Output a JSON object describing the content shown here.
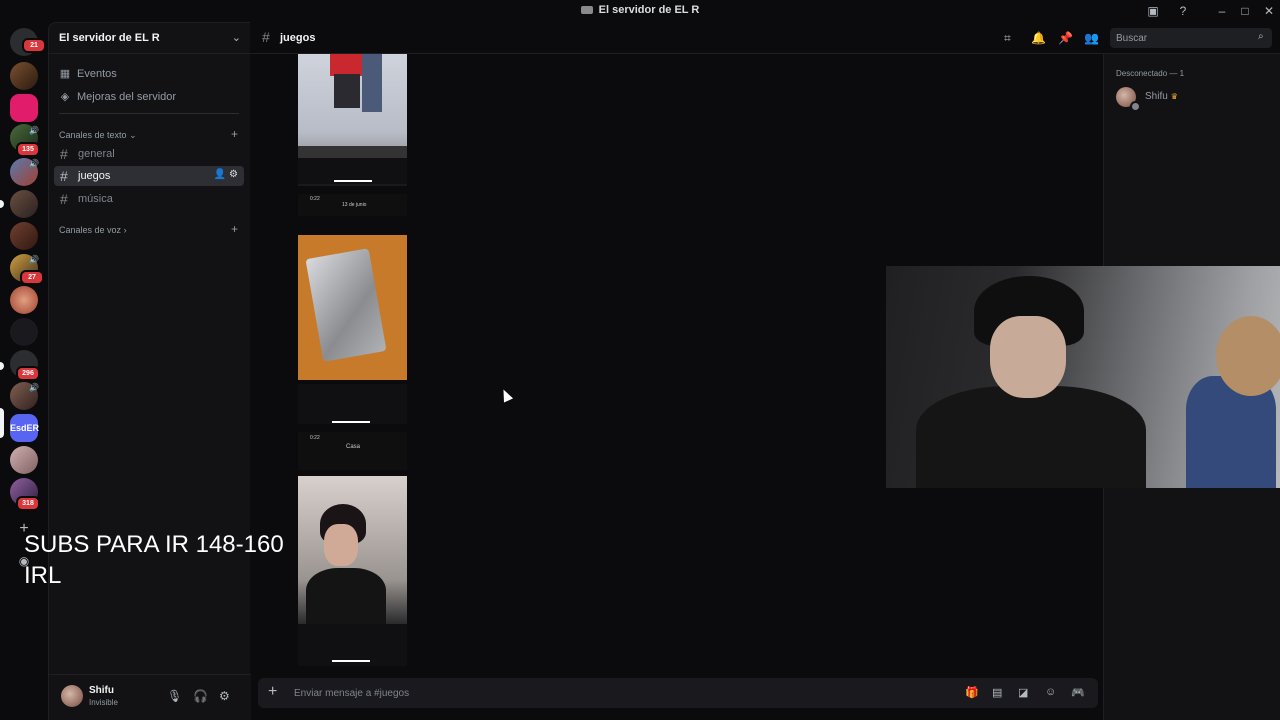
{
  "window": {
    "title": "El servidor de EL R"
  },
  "rail": {
    "badges": [
      "21",
      "135",
      "27",
      "296",
      "318"
    ],
    "text_server": "EsdER"
  },
  "server": {
    "name": "El servidor de EL R",
    "links": [
      {
        "label": "Eventos",
        "icon": "calendar-icon"
      },
      {
        "label": "Mejoras del servidor",
        "icon": "boost-icon"
      }
    ],
    "text_category": "Canales de texto",
    "voice_category": "Canales de voz",
    "channels": [
      "general",
      "juegos",
      "música"
    ],
    "active_channel": "juegos"
  },
  "user": {
    "name": "Shifu",
    "status": "Invisible"
  },
  "header": {
    "channel": "juegos",
    "search_placeholder": "Buscar"
  },
  "composer": {
    "placeholder": "Enviar mensaje a #juegos"
  },
  "members": {
    "section": "Desconectado — 1",
    "list": [
      {
        "name": "Shifu",
        "owner": true
      }
    ]
  },
  "shots": {
    "date_label": "13 de junio",
    "clock": "0:22",
    "contact_label": "Casa"
  },
  "overlay": {
    "text": "SUBS PARA IR 148-160\nIRL"
  },
  "colors": {
    "accent": "#5865f2",
    "badge": "#da373c",
    "crown": "#f0b232"
  }
}
